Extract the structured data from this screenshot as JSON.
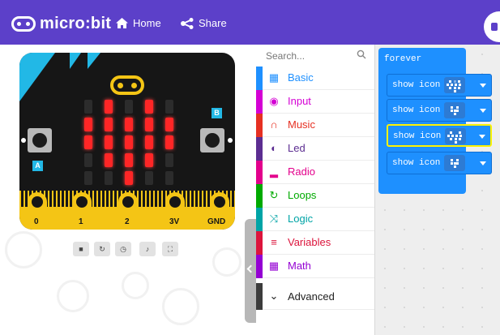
{
  "header": {
    "logo_text": "micro:bit",
    "nav": [
      {
        "label": "Home",
        "icon": "home-icon"
      },
      {
        "label": "Share",
        "icon": "share-icon"
      }
    ],
    "colors": {
      "bar": "#5c40c9"
    }
  },
  "simulator": {
    "buttons": {
      "a": "A",
      "b": "B"
    },
    "pins": [
      "0",
      "1",
      "2",
      "3V",
      "GND"
    ],
    "controls": [
      "stop-icon",
      "restart-icon",
      "slowmo-icon",
      "sound-icon",
      "fullscreen-icon"
    ]
  },
  "toolbox": {
    "search_placeholder": "Search...",
    "categories": [
      {
        "label": "Basic",
        "color": "#1e90ff",
        "icon": "grid-icon"
      },
      {
        "label": "Input",
        "color": "#d400d4",
        "icon": "target-icon"
      },
      {
        "label": "Music",
        "color": "#e63022",
        "icon": "headphones-icon"
      },
      {
        "label": "Led",
        "color": "#5c2d91",
        "icon": "toggle-icon"
      },
      {
        "label": "Radio",
        "color": "#e3008c",
        "icon": "signal-bars-icon"
      },
      {
        "label": "Loops",
        "color": "#00aa00",
        "icon": "refresh-icon"
      },
      {
        "label": "Logic",
        "color": "#00a4a6",
        "icon": "shuffle-icon"
      },
      {
        "label": "Variables",
        "color": "#dc143c",
        "icon": "lines-icon"
      },
      {
        "label": "Math",
        "color": "#9400d3",
        "icon": "calculator-icon"
      },
      {
        "label": "Advanced",
        "color": "#3c3c3c",
        "icon": "chevron-down-icon"
      }
    ]
  },
  "workspace": {
    "event_label": "forever",
    "blocks": [
      {
        "label": "show icon",
        "icon": "heart-icon",
        "selected": false
      },
      {
        "label": "show icon",
        "icon": "small-heart-icon",
        "selected": false
      },
      {
        "label": "show icon",
        "icon": "heart-icon",
        "selected": true
      },
      {
        "label": "show icon",
        "icon": "small-heart-icon",
        "selected": false
      }
    ]
  }
}
